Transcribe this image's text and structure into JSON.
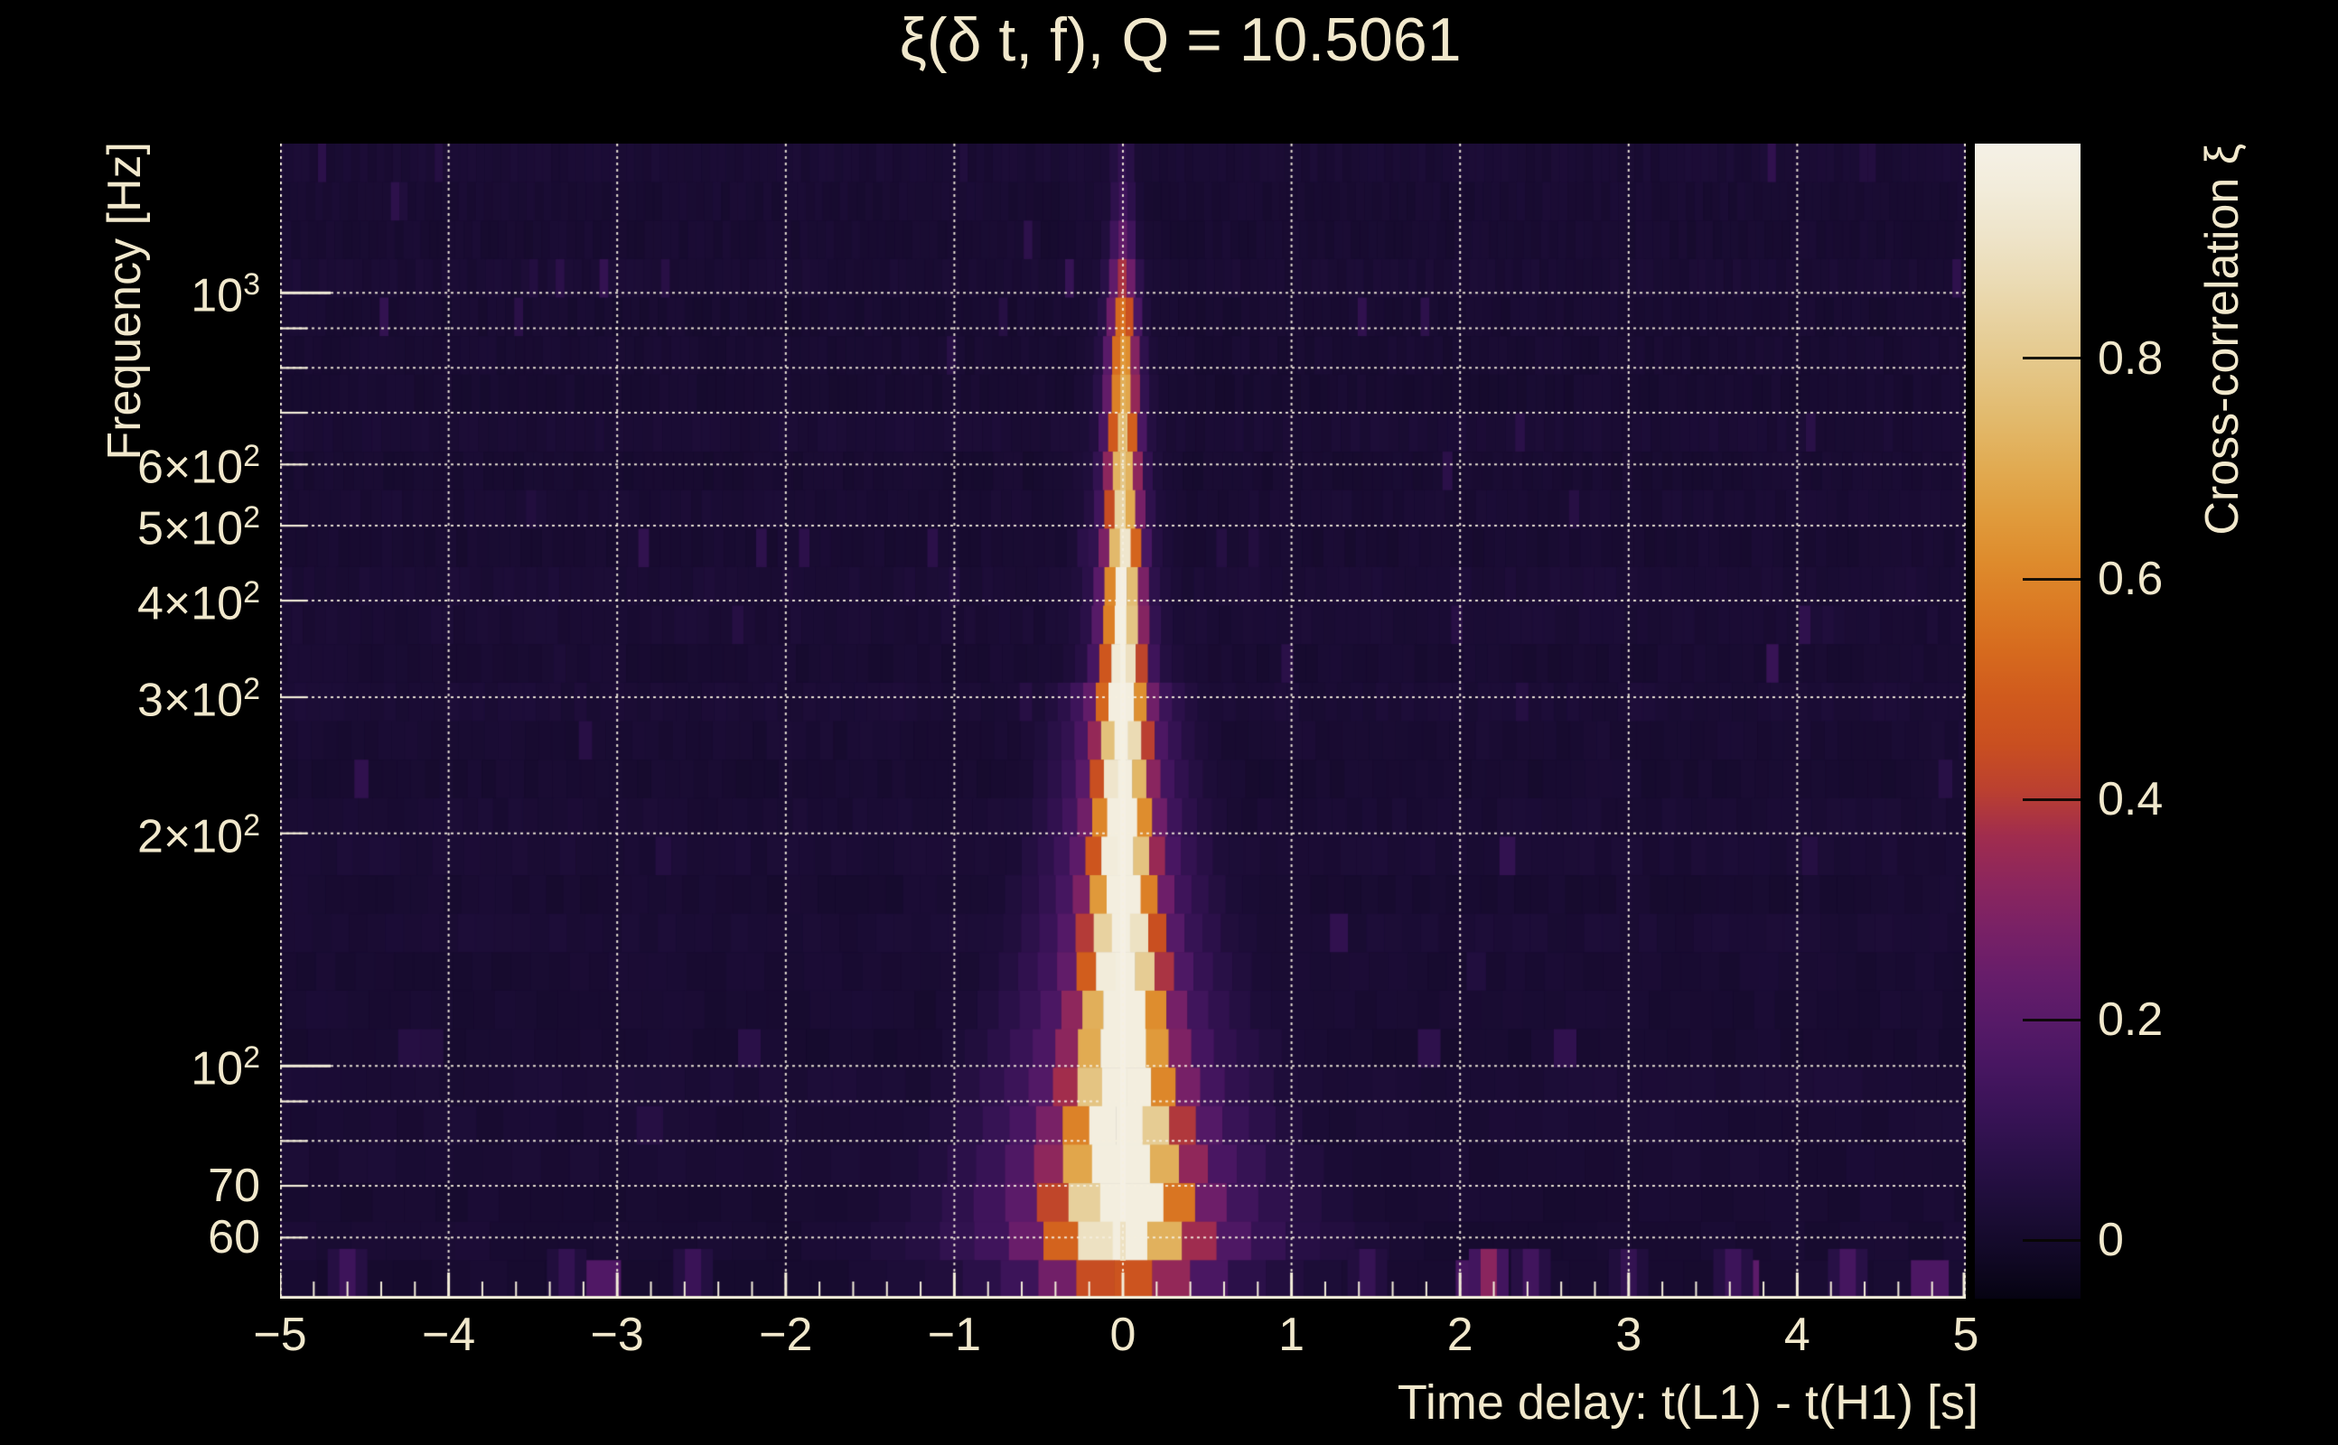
{
  "figure": {
    "background": "#000000",
    "text_color": "#f1e8cc",
    "grid_color": "#f6f0de",
    "axis_color": "#f3edd9"
  },
  "chart_data": {
    "type": "heatmap",
    "title": "ξ(δ t, f), Q = 10.5061",
    "xlabel": "Time delay: t(L1) - t(H1) [s]",
    "ylabel": "Frequency [Hz]",
    "x_range": [
      -5,
      5
    ],
    "x_major_ticks": [
      {
        "t": -5,
        "label": "−5"
      },
      {
        "t": -4,
        "label": "−4"
      },
      {
        "t": -3,
        "label": "−3"
      },
      {
        "t": -2,
        "label": "−2"
      },
      {
        "t": -1,
        "label": "−1"
      },
      {
        "t": 0,
        "label": "0"
      },
      {
        "t": 1,
        "label": "1"
      },
      {
        "t": 2,
        "label": "2"
      },
      {
        "t": 3,
        "label": "3"
      },
      {
        "t": 4,
        "label": "4"
      },
      {
        "t": 5,
        "label": "5"
      }
    ],
    "x_minor_step": 0.2,
    "y_scale": "log",
    "y_range_hz": [
      50,
      1560
    ],
    "y_ticks": [
      {
        "f": 1000,
        "text": "10",
        "sup": "3"
      },
      {
        "f": 600,
        "text": "6×10",
        "sup": "2"
      },
      {
        "f": 500,
        "text": "5×10",
        "sup": "2"
      },
      {
        "f": 400,
        "text": "4×10",
        "sup": "2"
      },
      {
        "f": 300,
        "text": "3×10",
        "sup": "2"
      },
      {
        "f": 200,
        "text": "2×10",
        "sup": "2"
      },
      {
        "f": 100,
        "text": "10",
        "sup": "2"
      },
      {
        "f": 70,
        "text": "70",
        "sup": ""
      },
      {
        "f": 60,
        "text": "60",
        "sup": ""
      }
    ],
    "y_gridlines_hz": [
      60,
      70,
      80,
      90,
      100,
      200,
      300,
      400,
      500,
      600,
      700,
      800,
      900,
      1000
    ],
    "grid": true,
    "legend_position": "right-colorbar",
    "colorbar": {
      "label": "Cross-correlation ξ",
      "vmin": -0.053,
      "vmax": 0.995,
      "ticks": [
        {
          "v": 0,
          "label": "0"
        },
        {
          "v": 0.2,
          "label": "0.2"
        },
        {
          "v": 0.4,
          "label": "0.4"
        },
        {
          "v": 0.6,
          "label": "0.6"
        },
        {
          "v": 0.8,
          "label": "0.8"
        }
      ],
      "colormap_stops": [
        [
          0.0,
          "#060312"
        ],
        [
          0.04,
          "#120927"
        ],
        [
          0.08,
          "#1d0d38"
        ],
        [
          0.12,
          "#2a1048"
        ],
        [
          0.16,
          "#381356"
        ],
        [
          0.2,
          "#471661"
        ],
        [
          0.24,
          "#571a68"
        ],
        [
          0.28,
          "#671d6a"
        ],
        [
          0.32,
          "#792166"
        ],
        [
          0.36,
          "#8c265d"
        ],
        [
          0.4,
          "#a02c4e"
        ],
        [
          0.44,
          "#bb4030"
        ],
        [
          0.48,
          "#c94f20"
        ],
        [
          0.52,
          "#d05a1d"
        ],
        [
          0.56,
          "#d66a1e"
        ],
        [
          0.6,
          "#db7b24"
        ],
        [
          0.64,
          "#de8c2d"
        ],
        [
          0.68,
          "#e09c3d"
        ],
        [
          0.72,
          "#e1ab52"
        ],
        [
          0.76,
          "#e2b96b"
        ],
        [
          0.8,
          "#e4c584"
        ],
        [
          0.84,
          "#e7d09c"
        ],
        [
          0.88,
          "#ebdbb4"
        ],
        [
          0.92,
          "#eee4c9"
        ],
        [
          0.96,
          "#f2ecda"
        ],
        [
          1.0,
          "#f5f1e6"
        ]
      ]
    },
    "ridge": {
      "t_center": 0.0,
      "core_halfwidth_s": 0.015,
      "profile": [
        {
          "f": 1560,
          "xi": 0.07
        },
        {
          "f": 1300,
          "xi": 0.12
        },
        {
          "f": 1100,
          "xi": 0.25
        },
        {
          "f": 1000,
          "xi": 0.42
        },
        {
          "f": 900,
          "xi": 0.55
        },
        {
          "f": 800,
          "xi": 0.62
        },
        {
          "f": 700,
          "xi": 0.68
        },
        {
          "f": 600,
          "xi": 0.72
        },
        {
          "f": 500,
          "xi": 0.8
        },
        {
          "f": 450,
          "xi": 0.88
        },
        {
          "f": 400,
          "xi": 0.92
        },
        {
          "f": 350,
          "xi": 0.9
        },
        {
          "f": 300,
          "xi": 0.93
        },
        {
          "f": 250,
          "xi": 0.9
        },
        {
          "f": 200,
          "xi": 0.94
        },
        {
          "f": 150,
          "xi": 0.92
        },
        {
          "f": 120,
          "xi": 0.95
        },
        {
          "f": 100,
          "xi": 0.96
        },
        {
          "f": 85,
          "xi": 0.97
        },
        {
          "f": 75,
          "xi": 0.96
        },
        {
          "f": 65,
          "xi": 0.93
        },
        {
          "f": 58,
          "xi": 0.8
        },
        {
          "f": 53,
          "xi": 0.4
        },
        {
          "f": 50,
          "xi": 0.15
        }
      ]
    },
    "bottom_band_features": [
      {
        "t": 2.17,
        "xi": 0.32
      },
      {
        "t": 2.42,
        "xi": 0.14
      },
      {
        "t": 3.0,
        "xi": 0.1
      },
      {
        "t": 3.62,
        "xi": 0.13
      },
      {
        "t": 4.3,
        "xi": 0.15
      },
      {
        "t": -2.55,
        "xi": 0.12
      },
      {
        "t": -4.6,
        "xi": 0.13
      },
      {
        "t": -3.3,
        "xi": 0.1
      },
      {
        "t": 1.45,
        "xi": 0.11
      }
    ],
    "noise": {
      "base_xi": 0.012,
      "column_variation": 0.018,
      "seed": 42
    }
  }
}
